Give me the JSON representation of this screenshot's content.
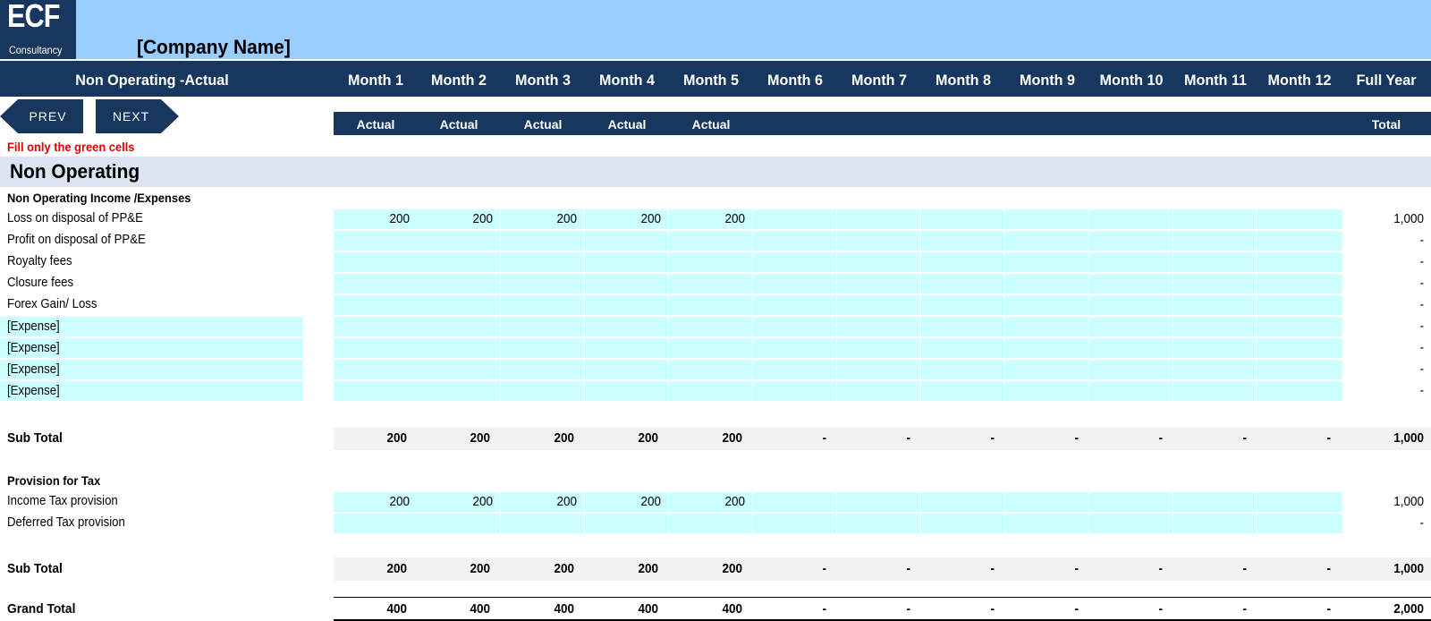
{
  "header": {
    "logo_main": "ECF",
    "logo_sub": "Consultancy",
    "company_name": "[Company Name]",
    "sheet_title": "Non Operating -Actual",
    "nav": {
      "prev": "PREV",
      "next": "NEXT"
    },
    "months": [
      "Month 1",
      "Month 2",
      "Month 3",
      "Month 4",
      "Month 5",
      "Month 6",
      "Month 7",
      "Month 8",
      "Month 9",
      "Month 10",
      "Month 11",
      "Month 12"
    ],
    "full_year": "Full Year",
    "sub_labels": [
      "Actual",
      "Actual",
      "Actual",
      "Actual",
      "Actual",
      "",
      "",
      "",
      "",
      "",
      "",
      ""
    ],
    "total_label": "Total"
  },
  "instruction": "Fill only the green cells",
  "section": {
    "title": "Non Operating",
    "group1": {
      "title": "Non Operating Income /Expenses",
      "rows": [
        {
          "label": "Loss on disposal of PP&E",
          "label_input": false,
          "values": [
            "200",
            "200",
            "200",
            "200",
            "200",
            "",
            "",
            "",
            "",
            "",
            "",
            ""
          ],
          "total": "1,000"
        },
        {
          "label": "Profit on disposal of PP&E",
          "label_input": false,
          "values": [
            "",
            "",
            "",
            "",
            "",
            "",
            "",
            "",
            "",
            "",
            "",
            ""
          ],
          "total": "-"
        },
        {
          "label": "Royalty fees",
          "label_input": false,
          "values": [
            "",
            "",
            "",
            "",
            "",
            "",
            "",
            "",
            "",
            "",
            "",
            ""
          ],
          "total": "-"
        },
        {
          "label": "Closure fees",
          "label_input": false,
          "values": [
            "",
            "",
            "",
            "",
            "",
            "",
            "",
            "",
            "",
            "",
            "",
            ""
          ],
          "total": "-"
        },
        {
          "label": "Forex Gain/ Loss",
          "label_input": false,
          "values": [
            "",
            "",
            "",
            "",
            "",
            "",
            "",
            "",
            "",
            "",
            "",
            ""
          ],
          "total": "-"
        },
        {
          "label": "[Expense]",
          "label_input": true,
          "values": [
            "",
            "",
            "",
            "",
            "",
            "",
            "",
            "",
            "",
            "",
            "",
            ""
          ],
          "total": "-"
        },
        {
          "label": "[Expense]",
          "label_input": true,
          "values": [
            "",
            "",
            "",
            "",
            "",
            "",
            "",
            "",
            "",
            "",
            "",
            ""
          ],
          "total": "-"
        },
        {
          "label": "[Expense]",
          "label_input": true,
          "values": [
            "",
            "",
            "",
            "",
            "",
            "",
            "",
            "",
            "",
            "",
            "",
            ""
          ],
          "total": "-"
        },
        {
          "label": "[Expense]",
          "label_input": true,
          "values": [
            "",
            "",
            "",
            "",
            "",
            "",
            "",
            "",
            "",
            "",
            "",
            ""
          ],
          "total": "-"
        }
      ],
      "subtotal": {
        "label": "Sub Total",
        "values": [
          "200",
          "200",
          "200",
          "200",
          "200",
          "-",
          "-",
          "-",
          "-",
          "-",
          "-",
          "-"
        ],
        "total": "1,000"
      }
    },
    "group2": {
      "title": "Provision for Tax",
      "rows": [
        {
          "label": "Income Tax provision",
          "label_input": false,
          "values": [
            "200",
            "200",
            "200",
            "200",
            "200",
            "",
            "",
            "",
            "",
            "",
            "",
            ""
          ],
          "total": "1,000"
        },
        {
          "label": "Deferred Tax provision",
          "label_input": false,
          "values": [
            "",
            "",
            "",
            "",
            "",
            "",
            "",
            "",
            "",
            "",
            "",
            ""
          ],
          "total": "-"
        }
      ],
      "subtotal": {
        "label": "Sub Total",
        "values": [
          "200",
          "200",
          "200",
          "200",
          "200",
          "-",
          "-",
          "-",
          "-",
          "-",
          "-",
          "-"
        ],
        "total": "1,000"
      }
    },
    "grand_total": {
      "label": "Grand Total",
      "values": [
        "400",
        "400",
        "400",
        "400",
        "400",
        "-",
        "-",
        "-",
        "-",
        "-",
        "-",
        "-"
      ],
      "total": "2,000"
    }
  }
}
